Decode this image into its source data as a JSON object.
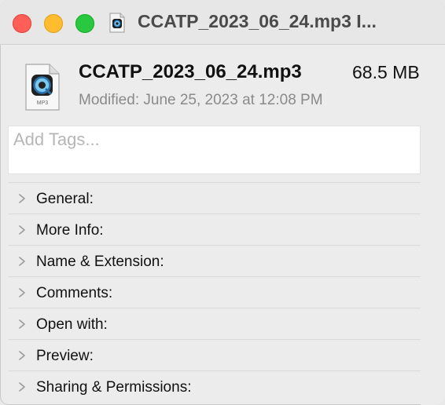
{
  "window": {
    "title": "CCATP_2023_06_24.mp3 I..."
  },
  "file": {
    "name": "CCATP_2023_06_24.mp3",
    "size": "68.5 MB",
    "modified": "Modified: June 25, 2023 at 12:08 PM",
    "icon_caption": "MP3",
    "icon": "quicktime-audio-file-icon"
  },
  "tags": {
    "placeholder": "Add Tags...",
    "value": ""
  },
  "sections": [
    {
      "label": "General:"
    },
    {
      "label": "More Info:"
    },
    {
      "label": "Name & Extension:"
    },
    {
      "label": "Comments:"
    },
    {
      "label": "Open with:"
    },
    {
      "label": "Preview:"
    },
    {
      "label": "Sharing & Permissions:"
    }
  ],
  "colors": {
    "close": "#ff5f57",
    "minimize": "#febc2e",
    "maximize": "#28c840"
  }
}
